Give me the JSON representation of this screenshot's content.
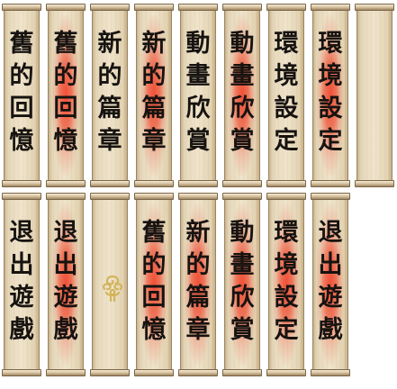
{
  "rows": [
    {
      "scrolls": [
        {
          "name": "scroll-memories",
          "text": "舊的回憶",
          "highlight": false
        },
        {
          "name": "scroll-memories-hl",
          "text": "舊的回憶",
          "highlight": true
        },
        {
          "name": "scroll-new-chapter",
          "text": "新的篇章",
          "highlight": false
        },
        {
          "name": "scroll-new-chapter-hl",
          "text": "新的篇章",
          "highlight": true
        },
        {
          "name": "scroll-animation-gallery",
          "text": "動畫欣賞",
          "highlight": false
        },
        {
          "name": "scroll-animation-gallery-hl",
          "text": "動畫欣賞",
          "highlight": true
        },
        {
          "name": "scroll-settings",
          "text": "環境設定",
          "highlight": false
        },
        {
          "name": "scroll-settings-hl",
          "text": "環境設定",
          "highlight": true
        },
        {
          "name": "scroll-blank",
          "text": "",
          "highlight": false
        }
      ]
    },
    {
      "scrolls": [
        {
          "name": "scroll-exit-game",
          "text": "退出遊戲",
          "highlight": false
        },
        {
          "name": "scroll-exit-game-hl",
          "text": "退出遊戲",
          "highlight": true
        },
        {
          "name": "scroll-emblem",
          "text": "",
          "highlight": false,
          "icon": "cloud-swirl-icon"
        },
        {
          "name": "scroll-memories-hl-2",
          "text": "舊的回憶",
          "highlight": true
        },
        {
          "name": "scroll-new-chapter-hl-2",
          "text": "新的篇章",
          "highlight": true
        },
        {
          "name": "scroll-animation-gallery-hl-2",
          "text": "動畫欣賞",
          "highlight": true
        },
        {
          "name": "scroll-settings-hl-2",
          "text": "環境設定",
          "highlight": true
        },
        {
          "name": "scroll-exit-game-hl-2",
          "text": "退出遊戲",
          "highlight": true
        }
      ]
    }
  ],
  "colors": {
    "highlight": "#ee4a30",
    "ink": "#161310",
    "paper": "#efe4cb",
    "rod": "#cdb893"
  }
}
